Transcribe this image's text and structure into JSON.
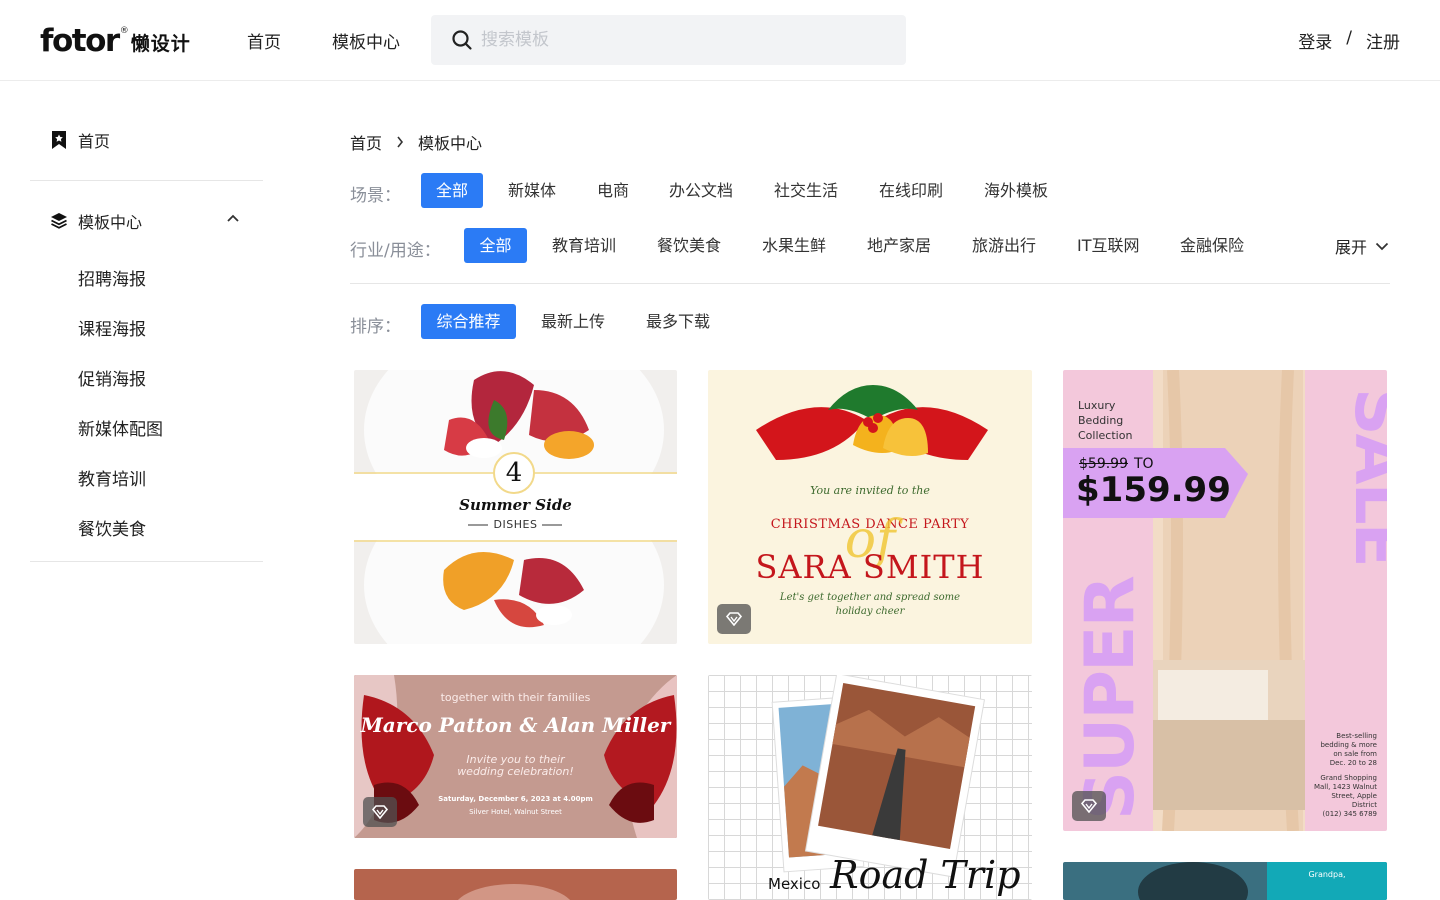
{
  "header": {
    "logo_en": "fotor",
    "logo_reg": "®",
    "logo_cn": "懒设计",
    "nav": [
      "首页",
      "模板中心"
    ],
    "search_placeholder": "搜索模板",
    "login": "登录",
    "separator": "/",
    "register": "注册"
  },
  "sidebar": {
    "home": "首页",
    "group": "模板中心",
    "items": [
      "招聘海报",
      "课程海报",
      "促销海报",
      "新媒体配图",
      "教育培训",
      "餐饮美食"
    ]
  },
  "breadcrumb": [
    "首页",
    "模板中心"
  ],
  "filters": {
    "scene_label": "场景：",
    "scene": [
      "全部",
      "新媒体",
      "电商",
      "办公文档",
      "社交生活",
      "在线印刷",
      "海外模板"
    ],
    "industry_label": "行业/用途：",
    "industry": [
      "全部",
      "教育培训",
      "餐饮美食",
      "水果生鲜",
      "地产家居",
      "旅游出行",
      "IT互联网",
      "金融保险"
    ],
    "expand": "展开",
    "sort_label": "排序：",
    "sort": [
      "综合推荐",
      "最新上传",
      "最多下载"
    ]
  },
  "cards": {
    "summer": {
      "number": "4",
      "title": "Summer Side",
      "subtitle": "DISHES"
    },
    "christmas": {
      "invited": "You are invited to the",
      "party": "CHRISTMAS DANCE PARTY",
      "of": "of",
      "name": "SARA SMITH",
      "line1": "Let's get together and spread some",
      "line2": "holiday cheer"
    },
    "sale": {
      "luxury1": "Luxury",
      "luxury2": "Bedding",
      "luxury3": "Collection",
      "old_price": "$59.99",
      "to": "TO",
      "new_price": "$159.99",
      "sale": "SALE",
      "super": "SUPER",
      "info1": "Best-selling",
      "info2": "bedding & more",
      "info3": "on sale from",
      "info4": "Dec. 20 to 28",
      "addr1": "Grand Shopping",
      "addr2": "Mall, 1423 Walnut",
      "addr3": "Street, Apple",
      "addr4": "District",
      "addr5": "(012) 345 6789"
    },
    "wedding": {
      "top": "together with their families",
      "names": "Marco Patton & Alan Miller",
      "invite1": "Invite you to their",
      "invite2": "wedding celebration!",
      "date": "Saturday, December 6, 2023 at 4.00pm",
      "place": "Silver Hotel, Walnut Street"
    },
    "roadtrip": {
      "mexico": "Mexico",
      "road": "Road Trip"
    },
    "grandpa": {
      "text": "Grandpa,"
    }
  },
  "colors": {
    "accent": "#2b7bf5",
    "sale_pink": "#f1c6dc",
    "sale_purple": "#d9a2f2"
  }
}
